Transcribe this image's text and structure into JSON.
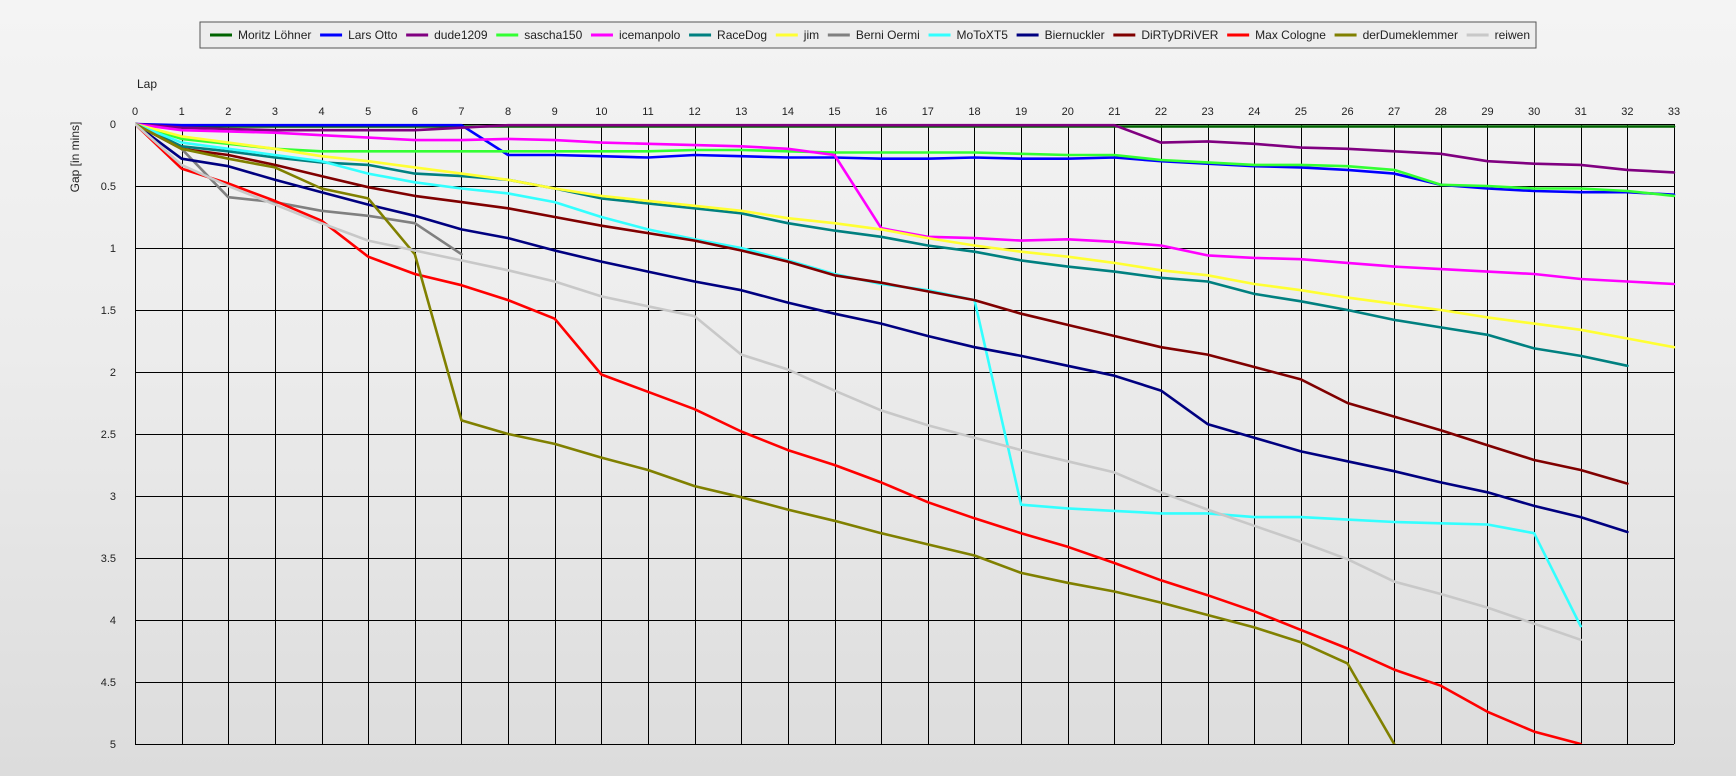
{
  "chart_data": {
    "type": "line",
    "xlabel": "Lap",
    "ylabel": "Gap [in mins]",
    "x_ticks": [
      0,
      1,
      2,
      3,
      4,
      5,
      6,
      7,
      8,
      9,
      10,
      11,
      12,
      13,
      14,
      15,
      16,
      17,
      18,
      19,
      20,
      21,
      22,
      23,
      24,
      25,
      26,
      27,
      28,
      29,
      30,
      31,
      32,
      33
    ],
    "y_ticks": [
      "0",
      "0.5",
      "1",
      "1.5",
      "2",
      "2.5",
      "3",
      "3.5",
      "4",
      "4.5",
      "5"
    ],
    "xlim": [
      0,
      33
    ],
    "ylim": [
      0,
      5
    ],
    "y_axis_inverted": true,
    "grid": true,
    "legend_position": "top-center",
    "series": [
      {
        "name": "Moritz Löhner",
        "color": "#006400",
        "values": [
          0,
          0.02,
          0.02,
          0.02,
          0.02,
          0.02,
          0.02,
          0.02,
          0.02,
          0.02,
          0.02,
          0.02,
          0.02,
          0.02,
          0.02,
          0.02,
          0.02,
          0.02,
          0.02,
          0.02,
          0.02,
          0.02,
          0.02,
          0.02,
          0.02,
          0.02,
          0.02,
          0.02,
          0.02,
          0.02,
          0.02,
          0.02,
          0.02,
          0.02
        ]
      },
      {
        "name": "Lars Otto",
        "color": "#0000FF",
        "values": [
          0,
          0.01,
          0.01,
          0.01,
          0.01,
          0.01,
          0.01,
          0.01,
          0.25,
          0.25,
          0.26,
          0.27,
          0.25,
          0.26,
          0.27,
          0.27,
          0.28,
          0.28,
          0.27,
          0.28,
          0.28,
          0.27,
          0.3,
          0.32,
          0.34,
          0.35,
          0.37,
          0.4,
          0.49,
          0.52,
          0.54,
          0.55,
          0.55,
          0.57
        ]
      },
      {
        "name": "dude1209",
        "color": "#800080",
        "values": [
          0,
          0.03,
          0.04,
          0.05,
          0.05,
          0.05,
          0.05,
          0.03,
          0.01,
          0.01,
          0.01,
          0.01,
          0.01,
          0.01,
          0.01,
          0.01,
          0.01,
          0.01,
          0.01,
          0.01,
          0.01,
          0.01,
          0.15,
          0.14,
          0.16,
          0.19,
          0.2,
          0.22,
          0.24,
          0.3,
          0.32,
          0.33,
          0.37,
          0.39
        ]
      },
      {
        "name": "sascha150",
        "color": "#33FF33",
        "values": [
          0,
          0.12,
          0.16,
          0.2,
          0.22,
          0.22,
          0.22,
          0.22,
          0.22,
          0.22,
          0.22,
          0.22,
          0.21,
          0.21,
          0.22,
          0.23,
          0.23,
          0.23,
          0.23,
          0.24,
          0.25,
          0.25,
          0.29,
          0.31,
          0.33,
          0.33,
          0.34,
          0.37,
          0.49,
          0.5,
          0.52,
          0.52,
          0.54,
          0.58
        ]
      },
      {
        "name": "icemanpolo",
        "color": "#FF00FF",
        "values": [
          0,
          0.05,
          0.06,
          0.07,
          0.09,
          0.11,
          0.13,
          0.13,
          0.12,
          0.13,
          0.15,
          0.16,
          0.17,
          0.18,
          0.2,
          0.25,
          0.84,
          0.91,
          0.92,
          0.94,
          0.93,
          0.95,
          0.98,
          1.06,
          1.08,
          1.09,
          1.12,
          1.15,
          1.17,
          1.19,
          1.21,
          1.25,
          1.27,
          1.29
        ]
      },
      {
        "name": "RaceDog",
        "color": "#008080",
        "values": [
          0,
          0.18,
          0.22,
          0.27,
          0.31,
          0.33,
          0.4,
          0.42,
          0.45,
          0.52,
          0.6,
          0.64,
          0.68,
          0.72,
          0.8,
          0.86,
          0.91,
          0.98,
          1.03,
          1.1,
          1.15,
          1.19,
          1.24,
          1.27,
          1.37,
          1.43,
          1.5,
          1.58,
          1.64,
          1.7,
          1.81,
          1.87,
          1.95,
          null
        ]
      },
      {
        "name": "jim",
        "color": "#FFFF33",
        "values": [
          0,
          0.1,
          0.15,
          0.2,
          0.26,
          0.3,
          0.35,
          0.4,
          0.45,
          0.52,
          0.58,
          0.62,
          0.66,
          0.7,
          0.76,
          0.8,
          0.85,
          0.92,
          0.98,
          1.03,
          1.07,
          1.12,
          1.18,
          1.22,
          1.29,
          1.34,
          1.4,
          1.45,
          1.5,
          1.56,
          1.61,
          1.66,
          1.73,
          1.8
        ]
      },
      {
        "name": "Berni Oermi",
        "color": "#808080",
        "values": [
          0,
          0.2,
          0.59,
          0.63,
          0.7,
          0.74,
          0.8,
          1.05,
          null,
          null,
          null,
          null,
          null,
          null,
          null,
          null,
          null,
          null,
          null,
          null,
          null,
          null,
          null,
          null,
          null,
          null,
          null,
          null,
          null,
          null,
          null,
          null,
          null,
          null
        ]
      },
      {
        "name": "MoToXT5",
        "color": "#33FFFF",
        "values": [
          0,
          0.15,
          0.2,
          0.25,
          0.3,
          0.4,
          0.47,
          0.52,
          0.56,
          0.63,
          0.75,
          0.85,
          0.93,
          1.0,
          1.1,
          1.21,
          1.29,
          1.34,
          1.42,
          3.07,
          3.1,
          3.12,
          3.14,
          3.14,
          3.17,
          3.17,
          3.19,
          3.21,
          3.22,
          3.23,
          3.3,
          4.05,
          null,
          null
        ]
      },
      {
        "name": "Biernuckler",
        "color": "#000080",
        "values": [
          0,
          0.28,
          0.34,
          0.45,
          0.55,
          0.65,
          0.74,
          0.85,
          0.92,
          1.02,
          1.11,
          1.19,
          1.27,
          1.34,
          1.44,
          1.53,
          1.61,
          1.71,
          1.8,
          1.87,
          1.95,
          2.03,
          2.15,
          2.42,
          2.53,
          2.64,
          2.72,
          2.8,
          2.89,
          2.97,
          3.08,
          3.17,
          3.29,
          null
        ]
      },
      {
        "name": "DiRTyDRiVER",
        "color": "#800000",
        "values": [
          0,
          0.2,
          0.25,
          0.33,
          0.42,
          0.51,
          0.58,
          0.63,
          0.68,
          0.75,
          0.82,
          0.88,
          0.94,
          1.02,
          1.11,
          1.22,
          1.28,
          1.35,
          1.42,
          1.53,
          1.62,
          1.71,
          1.8,
          1.86,
          1.96,
          2.06,
          2.25,
          2.36,
          2.47,
          2.59,
          2.71,
          2.79,
          2.9,
          null
        ]
      },
      {
        "name": "Max Cologne",
        "color": "#FF0000",
        "values": [
          0,
          0.36,
          0.48,
          0.62,
          0.78,
          1.07,
          1.21,
          1.3,
          1.42,
          1.57,
          2.02,
          2.16,
          2.3,
          2.48,
          2.63,
          2.75,
          2.89,
          3.05,
          3.18,
          3.3,
          3.41,
          3.54,
          3.68,
          3.8,
          3.93,
          4.08,
          4.23,
          4.4,
          4.53,
          4.74,
          4.9,
          5.0,
          null,
          null
        ]
      },
      {
        "name": "derDumeklemmer",
        "color": "#808000",
        "values": [
          0,
          0.2,
          0.28,
          0.35,
          0.52,
          0.6,
          1.05,
          2.39,
          2.5,
          2.58,
          2.69,
          2.79,
          2.92,
          3.01,
          3.11,
          3.2,
          3.3,
          3.39,
          3.48,
          3.62,
          3.7,
          3.77,
          3.86,
          3.96,
          4.06,
          4.18,
          4.35,
          5.0,
          null,
          null,
          null,
          null,
          null,
          null
        ]
      },
      {
        "name": "reiwen",
        "color": "#C8C8C8",
        "values": [
          0,
          0.33,
          0.5,
          0.65,
          0.8,
          0.94,
          1.02,
          1.1,
          1.18,
          1.27,
          1.39,
          1.47,
          1.55,
          1.86,
          1.98,
          2.15,
          2.31,
          2.43,
          2.53,
          2.63,
          2.72,
          2.81,
          2.97,
          3.11,
          3.24,
          3.37,
          3.51,
          3.69,
          3.79,
          3.9,
          4.03,
          4.16,
          null,
          null
        ]
      }
    ]
  }
}
